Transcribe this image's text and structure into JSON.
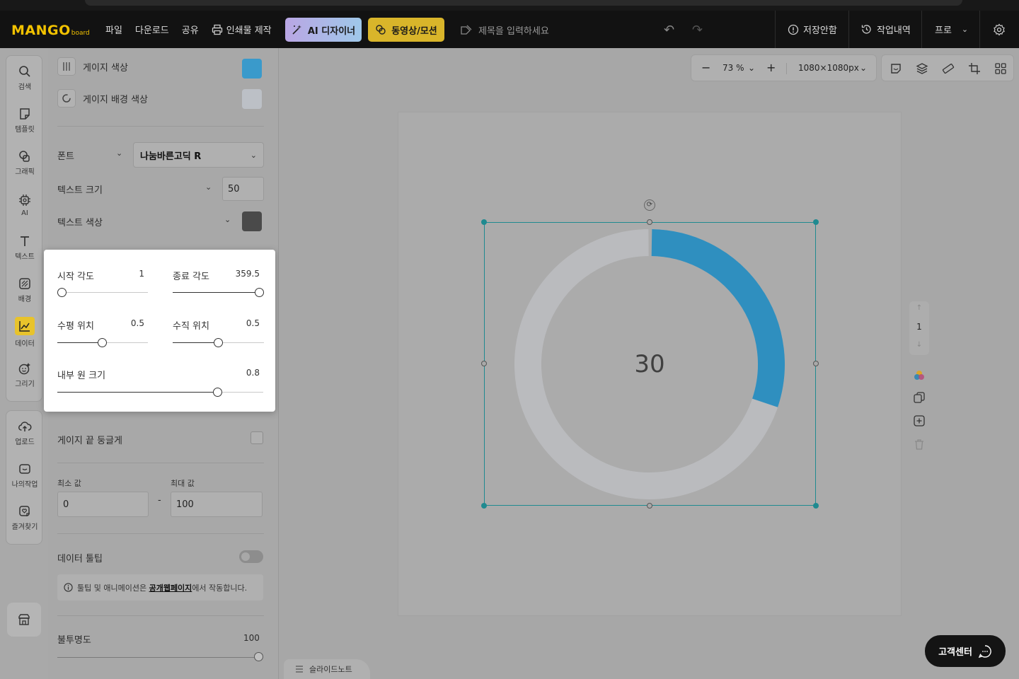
{
  "brand": {
    "logo_main": "MANGO",
    "logo_sub": "board"
  },
  "header": {
    "nav": [
      "파일",
      "다운로드",
      "공유"
    ],
    "print_label": "인쇄물 제작",
    "ai_designer": "AI 디자이너",
    "motion": "동영상/모션",
    "title_placeholder": "제목을 입력하세요",
    "unsaved": "저장안함",
    "history": "작업내역",
    "plan": "프로"
  },
  "rail": {
    "items": [
      "검색",
      "템플릿",
      "그래픽",
      "AI",
      "텍스트",
      "배경",
      "데이터",
      "그리기"
    ],
    "items2": [
      "업로드",
      "나의작업",
      "즐겨찾기"
    ]
  },
  "panel": {
    "gauge_color_label": "게이지 색상",
    "gauge_color": "#3a9acb",
    "gauge_bg_label": "게이지 배경 색상",
    "gauge_bg_color": "#c8ccd2",
    "font_label": "폰트",
    "font_value": "나눔바른고딕 R",
    "text_size_label": "텍스트 크기",
    "text_size_value": "50",
    "text_color_label": "텍스트 색상",
    "text_color": "#4a4a4a",
    "round_end_label": "게이지 끝 둥글게",
    "min_label": "최소 값",
    "max_label": "최대 값",
    "min_value": "0",
    "max_value": "100",
    "range_dash": "-",
    "tooltip_label": "데이터 툴팁",
    "info_pre": "툴팁 및 애니메이션은 ",
    "info_link": "공개웹페이지",
    "info_post": "에서 작동합니다.",
    "opacity_label": "불투명도",
    "opacity_value": "100"
  },
  "popup": {
    "start_angle_label": "시작 각도",
    "start_angle": "1",
    "end_angle_label": "종료 각도",
    "end_angle": "359.5",
    "h_pos_label": "수평 위치",
    "h_pos": "0.5",
    "v_pos_label": "수직 위치",
    "v_pos": "0.5",
    "inner_label": "내부 원 크기",
    "inner": "0.8"
  },
  "canvas": {
    "zoom": "73 %",
    "size": "1080×1080px",
    "page_number": "1"
  },
  "gauge": {
    "value": 30,
    "min": 0,
    "max": 100,
    "display": "30",
    "fill_color": "#2f8fbf",
    "bg_color": "#c6c9ce"
  },
  "bottom": {
    "slide_notes": "슬라이드노트",
    "support": "고객센터"
  }
}
